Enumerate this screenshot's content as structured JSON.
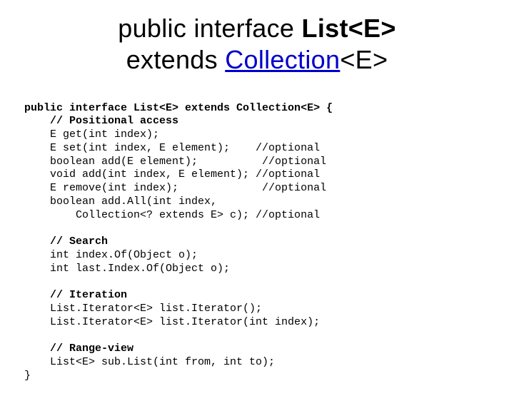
{
  "heading": {
    "l1_before": "public interface ",
    "l1_bold": "List<E>",
    "l2_before": "extends ",
    "l2_link": "Collection",
    "l2_after": "<E>"
  },
  "code": {
    "l01": "public interface List<E> extends Collection<E> {",
    "l02": "    // Positional access",
    "l03": "    E get(int index);",
    "l04": "    E set(int index, E element);    //optional",
    "l05": "    boolean add(E element);          //optional",
    "l06": "    void add(int index, E element); //optional",
    "l07": "    E remove(int index);             //optional",
    "l08": "    boolean add.All(int index,",
    "l09": "        Collection<? extends E> c); //optional",
    "l10": "",
    "l11": "    // Search",
    "l12": "    int index.Of(Object o);",
    "l13": "    int last.Index.Of(Object o);",
    "l14": "",
    "l15": "    // Iteration",
    "l16": "    List.Iterator<E> list.Iterator();",
    "l17": "    List.Iterator<E> list.Iterator(int index);",
    "l18": "",
    "l19": "    // Range-view",
    "l20": "    List<E> sub.List(int from, int to);",
    "l21": "}"
  }
}
